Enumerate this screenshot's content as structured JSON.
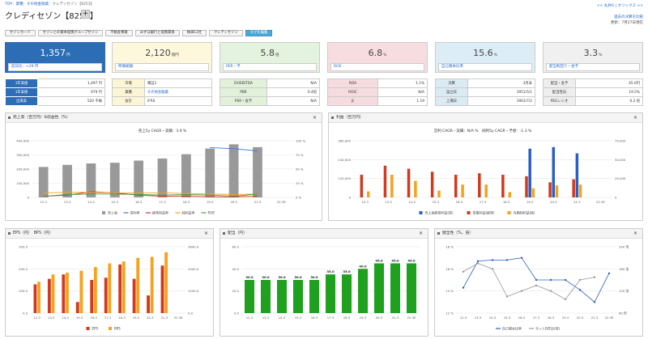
{
  "breadcrumb": {
    "top": "TOP",
    "sep": "：",
    "industry": "業種",
    "sep2": "：",
    "sector": "その他金融業",
    "sep3": "：",
    "company": "クレディセゾン【8253】"
  },
  "header": {
    "title": "クレディセゾン【8253】",
    "plus": "+",
    "links_right": "<< 丸井G | オリックス >>",
    "report_link": "過去の決算を比較",
    "update": "更新：7月27日現在"
  },
  "tabs": [
    "セゾンカード",
    "セゾンとの資本提携グループセゾン",
    "不動産事業",
    "みずほ銀行と提携関係",
    "株価12社",
    "クレディセゾン",
    "タグを編集"
  ],
  "cards": [
    {
      "value": "1,357",
      "unit": "円",
      "sub": "前日比：+29 円"
    },
    {
      "value": "2,120",
      "unit": "億円",
      "sub": "時価総額"
    },
    {
      "value": "5.8",
      "unit": "倍",
      "sub": "PER・予"
    },
    {
      "value": "6.8",
      "unit": "%",
      "sub": "ROE"
    },
    {
      "value": "15.6",
      "unit": "%",
      "sub": "自己資本比率"
    },
    {
      "value": "3.3",
      "unit": "%",
      "sub": "配当利回り・会予"
    }
  ],
  "metrics": [
    [
      [
        "1年高値",
        "1,497 円"
      ],
      [
        "1年安値",
        "979 円"
      ],
      [
        "出来高",
        "520 千株"
      ]
    ],
    [
      [
        "市場",
        "東証1"
      ],
      [
        "業種",
        "その他金融業"
      ],
      [
        "会計",
        "IFRS"
      ]
    ],
    [
      [
        "EV/EBITDA",
        "N/A"
      ],
      [
        "PBR",
        "0.4倍"
      ],
      [
        "PSR・会予",
        "N/A"
      ]
    ],
    [
      [
        "ROA",
        "1.1%"
      ],
      [
        "ROIC",
        "N/A"
      ],
      [
        "β",
        "1.19"
      ]
    ],
    [
      [
        "決算",
        "3月末"
      ],
      [
        "設立日",
        "1951/5/1"
      ],
      [
        "上場日",
        "1963/7/2"
      ]
    ],
    [
      [
        "配当・会予",
        "45.0円"
      ],
      [
        "配当性向",
        "19.5%"
      ],
      [
        "PEGレシオ",
        "0.2 倍"
      ]
    ]
  ],
  "panels": {
    "sales": {
      "title": "売上高（百万円）&収益性（%）",
      "subtitle": "売上5y CAGR・実績：3.9 %"
    },
    "profit": {
      "title": "利益（百万円）",
      "subtitle": "営利 CAGR・実績：N/A %　純利5y CAGR・予想：-1.3 %"
    },
    "eps": {
      "title": "EPS（円）　BPS（円）"
    },
    "div": {
      "title": "配当（円）"
    },
    "health": {
      "title": "健全性（%，倍）"
    },
    "close": "×"
  },
  "chart_data": [
    {
      "type": "bar",
      "title": "売上高（百万円）&収益性（%）",
      "subtitle": "売上5y CAGR・実績：3.9 %",
      "categories": [
        "12.3",
        "13.3",
        "14.3",
        "15.3",
        "16.3",
        "17.3",
        "18.3",
        "19.3",
        "20.3",
        "21.3",
        "22.3E"
      ],
      "y_left_ticks": [
        "400,000",
        "300,000",
        "200,000",
        "100,000",
        "0"
      ],
      "y_left_lim": [
        0,
        400000
      ],
      "y_right_ticks": [
        "100 %",
        "75 %",
        "50 %",
        "25 %",
        "0 %"
      ],
      "y_right_lim": [
        0,
        100
      ],
      "series": [
        {
          "name": "売上高",
          "kind": "bar",
          "color": "#999999",
          "values": [
            215000,
            230000,
            240000,
            245000,
            260000,
            275000,
            305000,
            345000,
            375000,
            355000,
            null
          ]
        },
        {
          "name": "営利率",
          "kind": "line",
          "color": "#3a78c8",
          "values": [
            null,
            null,
            null,
            null,
            null,
            null,
            null,
            88,
            86,
            82,
            null
          ]
        },
        {
          "name": "経常利益率",
          "kind": "line",
          "color": "#cc3322",
          "values": [
            2,
            4,
            10,
            8,
            4,
            2,
            2,
            1,
            1,
            2,
            null
          ]
        },
        {
          "name": "純利益率",
          "kind": "line",
          "color": "#f0a020",
          "values": [
            8,
            9,
            9,
            8,
            8,
            8,
            7,
            6,
            5,
            6,
            null
          ]
        },
        {
          "name": "ROE",
          "kind": "line",
          "color": "#4a9a3a",
          "values": [
            2,
            5,
            6,
            6,
            5,
            4,
            5,
            4,
            2,
            6,
            null
          ]
        }
      ]
    },
    {
      "type": "bar",
      "title": "利益（百万円）",
      "subtitle": "営利 CAGR・実績：N/A %　純利5y CAGR・予想：-1.3 %",
      "categories": [
        "12.3",
        "13.3",
        "14.3",
        "15.3",
        "16.3",
        "17.3",
        "18.3",
        "19.3",
        "20.3",
        "21.3",
        "22.3E"
      ],
      "y_left_ticks": [
        "360,000",
        "240,000",
        "120,000",
        "0"
      ],
      "y_left_lim": [
        0,
        360000
      ],
      "y_right_ticks": [
        "75,000",
        "50,000",
        "25,000",
        "0"
      ],
      "y_right_lim": [
        0,
        75000
      ],
      "series": [
        {
          "name": "売上高経常利益(営)",
          "color": "#2a5fc8",
          "values": [
            null,
            null,
            null,
            null,
            null,
            null,
            null,
            310000,
            320000,
            280000,
            null
          ]
        },
        {
          "name": "営業利益(経常)",
          "color": "#d03a1f",
          "values": [
            30000,
            42000,
            38000,
            34000,
            30000,
            32000,
            30000,
            28000,
            20000,
            24000,
            null
          ]
        },
        {
          "name": "当期純利益(純)",
          "color": "#f5a21f",
          "values": [
            8000,
            30000,
            22000,
            9000,
            17000,
            17000,
            7000,
            12000,
            16000,
            17000,
            null
          ]
        }
      ]
    },
    {
      "type": "bar",
      "title": "EPS（円）　BPS（円）",
      "categories": [
        "12.3",
        "13.3",
        "14.3",
        "15.3",
        "16.3",
        "17.3",
        "18.3",
        "19.3",
        "20.3",
        "21.3",
        "22.3E"
      ],
      "y_left_ticks": [
        "300.0",
        "200.0",
        "100.0",
        "0.0"
      ],
      "y_left_lim": [
        0,
        300
      ],
      "y_right_ticks": [
        "3600.0",
        "2400.0",
        "1200.0",
        "0.0"
      ],
      "y_right_lim": [
        0,
        3600
      ],
      "series": [
        {
          "name": "EPS",
          "color": "#d03a1f",
          "values": [
            130,
            155,
            175,
            50,
            150,
            160,
            220,
            155,
            80,
            215,
            null
          ]
        },
        {
          "name": "BPS",
          "color": "#f5a21f",
          "values": [
            1700,
            2100,
            2200,
            2300,
            2500,
            2700,
            2800,
            3000,
            3050,
            3300,
            null
          ]
        }
      ]
    },
    {
      "type": "bar",
      "title": "配当（円）",
      "categories": [
        "12.3",
        "13.3",
        "14.3",
        "15.3",
        "16.3",
        "17.3",
        "18.3",
        "19.3",
        "20.3",
        "21.3",
        "22.3E"
      ],
      "y_ticks": [
        "60.0",
        "40.0",
        "20.0",
        "0.0"
      ],
      "ylim": [
        0,
        60
      ],
      "series": [
        {
          "name": "配当",
          "color": "#1fa01f",
          "values": [
            30,
            30,
            30,
            30,
            30,
            35,
            35,
            40,
            45,
            45,
            45
          ],
          "labels": [
            "30.0",
            "30.0",
            "30.0",
            "30.0",
            "30.0",
            "35.0",
            "35.0",
            "40.0",
            "45.0",
            "45.0",
            "45.0"
          ]
        }
      ]
    },
    {
      "type": "line",
      "title": "健全性（%，倍）",
      "categories": [
        "12.3",
        "13.3",
        "14.3",
        "15.3",
        "16.3",
        "17.3",
        "18.3",
        "19.3",
        "20.3",
        "21.3",
        "22.3E"
      ],
      "y_left_ticks": [
        "18 %",
        "16 %",
        "14 %",
        "12 %"
      ],
      "y_left_lim": [
        12,
        18
      ],
      "y_right_ticks": [
        "240 倍",
        "180 倍",
        "120 倍",
        "60 倍"
      ],
      "y_right_lim": [
        0,
        240
      ],
      "series": [
        {
          "name": "自己資本比率",
          "color": "#2a5fc8",
          "values": [
            14.3,
            16.7,
            16.8,
            16.8,
            17.0,
            15.0,
            15.0,
            15.0,
            14.1,
            13.0,
            15.6
          ]
        },
        {
          "name": "ネットD/E比(倍)",
          "color": "#999999",
          "values": [
            150,
            180,
            160,
            60,
            80,
            100,
            80,
            50,
            120,
            130,
            null
          ]
        }
      ]
    }
  ]
}
